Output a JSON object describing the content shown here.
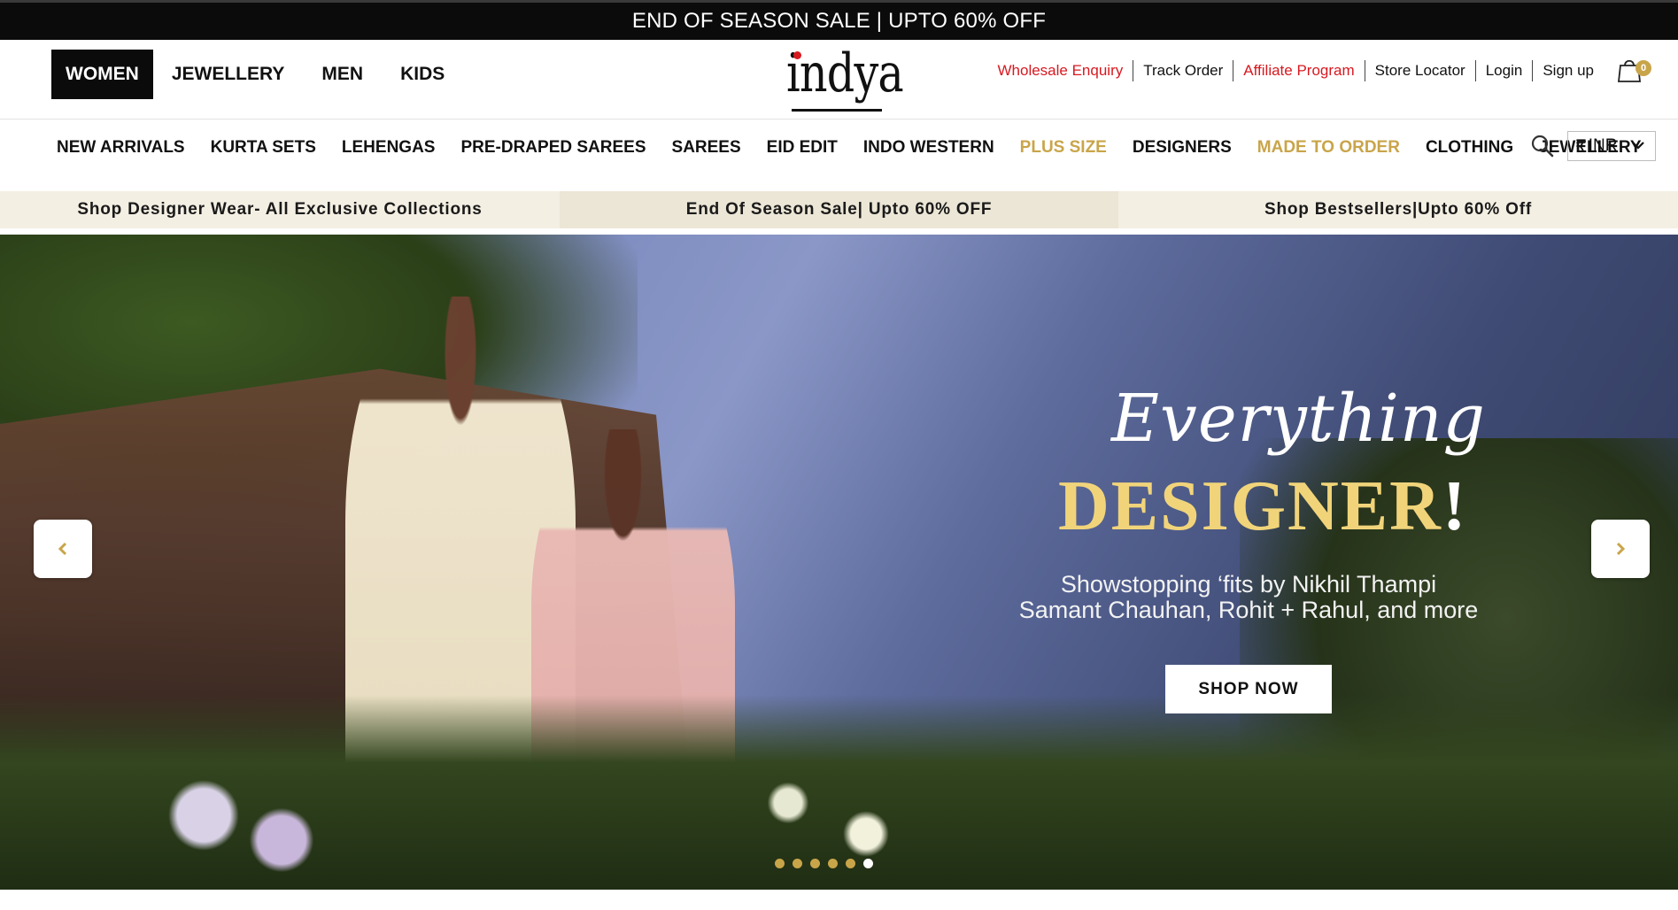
{
  "topbar": {
    "text": "END OF SEASON SALE | UPTO 60% OFF"
  },
  "gender_nav": [
    "WOMEN",
    "JEWELLERY",
    "MEN",
    "KIDS"
  ],
  "logo": {
    "text": "indya"
  },
  "utility_links": [
    {
      "label": "Wholesale Enquiry",
      "color": "#d71920"
    },
    {
      "label": "Track Order"
    },
    {
      "label": "Affiliate Program",
      "color": "#d71920"
    },
    {
      "label": "Store Locator"
    },
    {
      "label": "Login"
    },
    {
      "label": "Sign up"
    }
  ],
  "cart": {
    "count": "0",
    "icon": "shopping-bag-icon"
  },
  "categories": [
    "NEW ARRIVALS",
    "KURTA SETS",
    "LEHENGAS",
    "PRE-DRAPED SAREES",
    "SAREES",
    "EID EDIT",
    "INDO WESTERN",
    "PLUS SIZE",
    "DESIGNERS",
    "MADE TO ORDER",
    "CLOTHING",
    "JEWELLERY"
  ],
  "highlight_color": "#c9a54a",
  "currency": {
    "symbol": "₹",
    "value": "INR"
  },
  "promos": [
    "Shop Designer Wear- All Exclusive Collections",
    "End Of Season Sale| Upto 60% OFF",
    "Shop Bestsellers|Upto 60% Off"
  ],
  "hero": {
    "script_text": "Everything",
    "headline": "DESIGNER",
    "headline_mark": "!",
    "subtitle_line1": "Showstopping ‘fits by Nikhil Thampi",
    "subtitle_line2": "Samant Chauhan, Rohit + Rahul, and more",
    "cta": "SHOP NOW",
    "slides_total": 6,
    "active_slide": 6
  }
}
